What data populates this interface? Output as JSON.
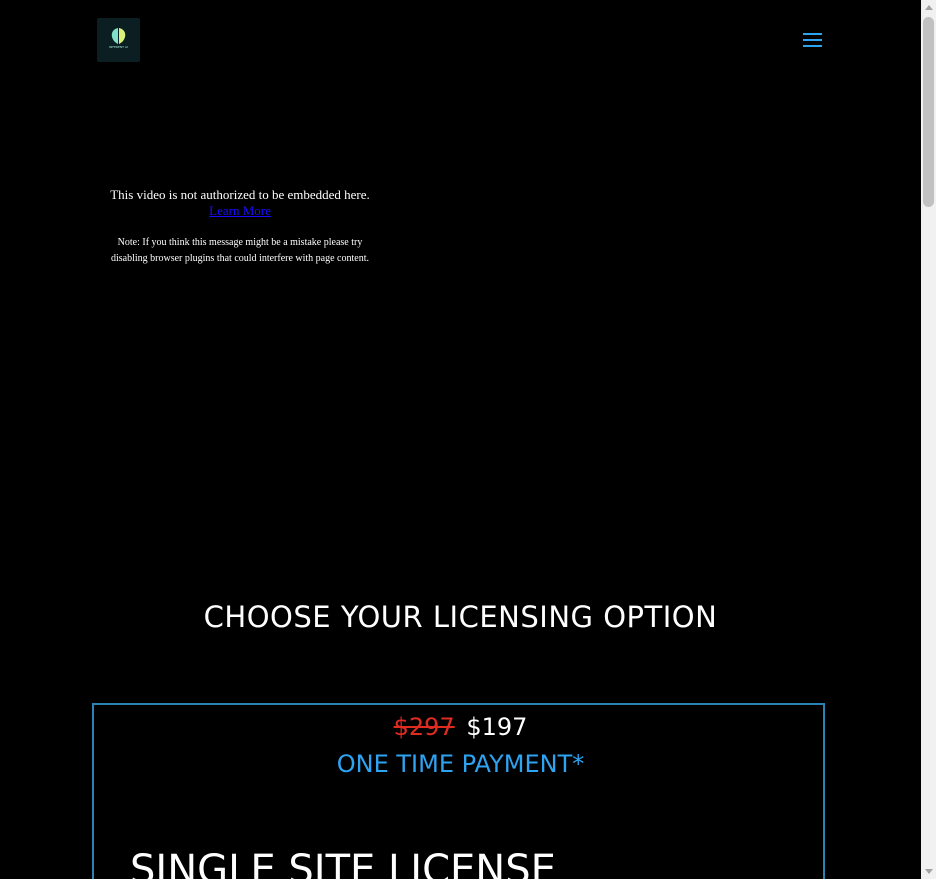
{
  "header": {
    "logo_icon": "brain-leaf-logo",
    "logo_text": "INFERENT AI",
    "menu_icon": "hamburger-menu-icon",
    "accent_color": "#2ea3f2"
  },
  "video": {
    "error_text": "This video is not authorized to be embedded here.",
    "learn_more_label": "Learn More",
    "note_text": "Note: If you think this message might be a mistake please try disabling browser plugins that could interfere with page content."
  },
  "section": {
    "title": "CHOOSE YOUR LICENSING OPTION"
  },
  "pricing": {
    "old_price": "$297",
    "new_price": "$197",
    "payment_type": "ONE TIME PAYMENT*",
    "license_title": "SINGLE SITE LICENSE",
    "border_color": "#2b83b5",
    "strike_color": "#e02b20"
  }
}
